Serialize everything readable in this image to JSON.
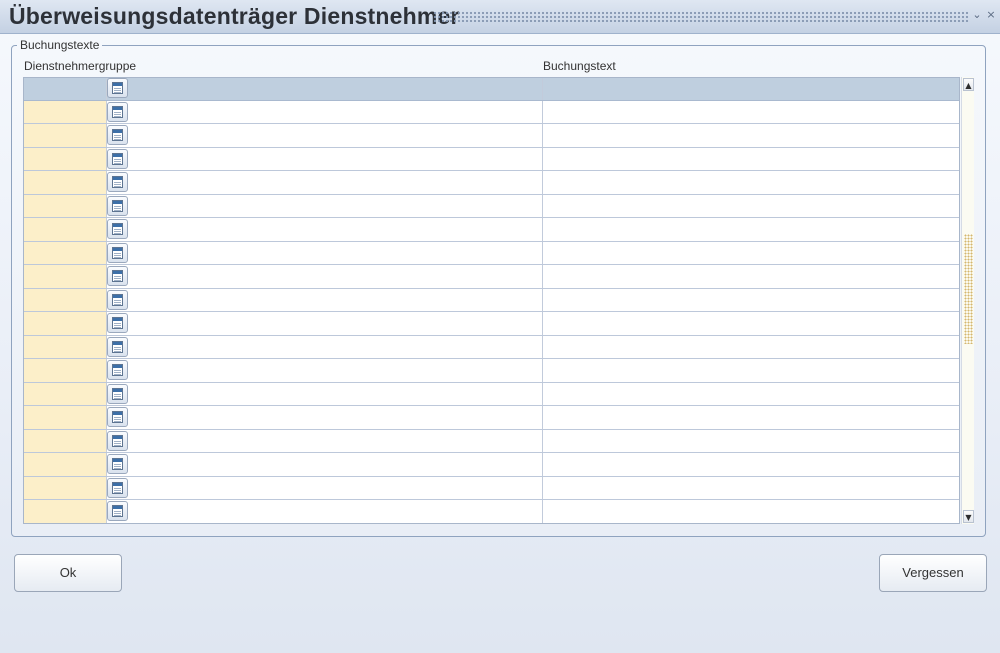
{
  "window": {
    "title": "Überweisungsdatenträger Dienstnehmer",
    "minimize_glyph": "⌄",
    "close_glyph": "×"
  },
  "section": {
    "legend": "Buchungstexte"
  },
  "table": {
    "columns": [
      "Dienstnehmergruppe",
      "Buchungstext"
    ],
    "row_count": 19,
    "rows": [
      {
        "group": "",
        "col2": "",
        "text": ""
      },
      {
        "group": "",
        "col2": "",
        "text": ""
      },
      {
        "group": "",
        "col2": "",
        "text": ""
      },
      {
        "group": "",
        "col2": "",
        "text": ""
      },
      {
        "group": "",
        "col2": "",
        "text": ""
      },
      {
        "group": "",
        "col2": "",
        "text": ""
      },
      {
        "group": "",
        "col2": "",
        "text": ""
      },
      {
        "group": "",
        "col2": "",
        "text": ""
      },
      {
        "group": "",
        "col2": "",
        "text": ""
      },
      {
        "group": "",
        "col2": "",
        "text": ""
      },
      {
        "group": "",
        "col2": "",
        "text": ""
      },
      {
        "group": "",
        "col2": "",
        "text": ""
      },
      {
        "group": "",
        "col2": "",
        "text": ""
      },
      {
        "group": "",
        "col2": "",
        "text": ""
      },
      {
        "group": "",
        "col2": "",
        "text": ""
      },
      {
        "group": "",
        "col2": "",
        "text": ""
      },
      {
        "group": "",
        "col2": "",
        "text": ""
      },
      {
        "group": "",
        "col2": "",
        "text": ""
      },
      {
        "group": "",
        "col2": "",
        "text": ""
      }
    ]
  },
  "scrollbar": {
    "up_glyph": "▲",
    "down_glyph": "▼"
  },
  "buttons": {
    "ok_label": "Ok",
    "cancel_label": "Vergessen"
  },
  "icons": {
    "lov": "list-of-values-icon",
    "scroll_up": "scroll-up-icon",
    "scroll_down": "scroll-down-icon"
  },
  "colors": {
    "titlebar": "#c9d5e6",
    "selected_row": "#bfcfdf",
    "group_cell": "#fcefc9",
    "border": "#8fa3bf"
  }
}
